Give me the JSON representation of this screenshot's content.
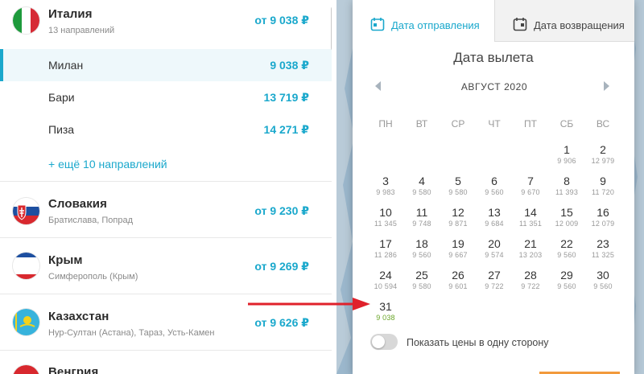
{
  "countries": [
    {
      "name": "Италия",
      "sub": "13 направлений",
      "price": "от 9 038 ₽",
      "flag": "italy-flag-icon"
    },
    {
      "name": "Словакия",
      "sub": "Братислава, Попрад",
      "price": "от 9 230 ₽",
      "flag": "slovakia-flag-icon"
    },
    {
      "name": "Крым",
      "sub": "Симферополь (Крым)",
      "price": "от 9 269 ₽",
      "flag": "crimea-flag-icon"
    },
    {
      "name": "Казахстан",
      "sub": "Нур-Султан (Астана), Тараз, Усть-Камен",
      "price": "от 9 626 ₽",
      "flag": "kazakhstan-flag-icon"
    },
    {
      "name": "Венгрия",
      "sub": "",
      "price": "",
      "flag": "hungary-flag-icon"
    }
  ],
  "cities": [
    {
      "name": "Милан",
      "price": "9 038 ₽"
    },
    {
      "name": "Бари",
      "price": "13 719 ₽"
    },
    {
      "name": "Пиза",
      "price": "14 271 ₽"
    }
  ],
  "more_link": "+ ещё 10 направлений",
  "calendar": {
    "tab_departure": "Дата отправления",
    "tab_return": "Дата возвращения",
    "title": "Дата вылета",
    "month": "АВГУСТ 2020",
    "weekdays": [
      "ПН",
      "ВТ",
      "СР",
      "ЧТ",
      "ПТ",
      "СБ",
      "ВС"
    ],
    "days": [
      {
        "d": "1",
        "p": "9 906"
      },
      {
        "d": "2",
        "p": "12 979"
      },
      {
        "d": "3",
        "p": "9 983"
      },
      {
        "d": "4",
        "p": "9 580"
      },
      {
        "d": "5",
        "p": "9 580"
      },
      {
        "d": "6",
        "p": "9 560"
      },
      {
        "d": "7",
        "p": "9 670"
      },
      {
        "d": "8",
        "p": "11 393"
      },
      {
        "d": "9",
        "p": "11 720"
      },
      {
        "d": "10",
        "p": "11 345"
      },
      {
        "d": "11",
        "p": "9 748"
      },
      {
        "d": "12",
        "p": "9 871"
      },
      {
        "d": "13",
        "p": "9 684"
      },
      {
        "d": "14",
        "p": "11 351"
      },
      {
        "d": "15",
        "p": "12 009"
      },
      {
        "d": "16",
        "p": "12 079"
      },
      {
        "d": "17",
        "p": "11 286"
      },
      {
        "d": "18",
        "p": "9 560"
      },
      {
        "d": "19",
        "p": "9 667"
      },
      {
        "d": "20",
        "p": "9 574"
      },
      {
        "d": "21",
        "p": "13 203"
      },
      {
        "d": "22",
        "p": "9 560"
      },
      {
        "d": "23",
        "p": "11 325"
      },
      {
        "d": "24",
        "p": "10 594"
      },
      {
        "d": "25",
        "p": "9 580"
      },
      {
        "d": "26",
        "p": "9 601"
      },
      {
        "d": "27",
        "p": "9 722"
      },
      {
        "d": "28",
        "p": "9 722"
      },
      {
        "d": "29",
        "p": "9 560"
      },
      {
        "d": "30",
        "p": "9 560"
      },
      {
        "d": "31",
        "p": "9 038"
      }
    ],
    "toggle_label": "Показать цены в одну сторону",
    "accent_color": "#1aa8cc",
    "best_price_color": "#6aa628"
  }
}
